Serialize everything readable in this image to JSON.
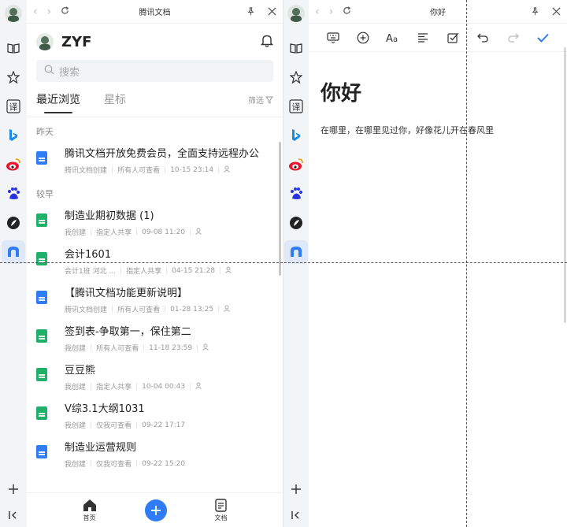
{
  "left_window": {
    "title": "腾讯文档",
    "user_name": "ZYF",
    "search_placeholder": "搜索",
    "tabs": [
      {
        "label": "最近浏览",
        "active": true
      },
      {
        "label": "星标",
        "active": false
      }
    ],
    "filter_label": "筛选",
    "groups": [
      {
        "label": "昨天",
        "items": [
          {
            "type": "doc",
            "title": "腾讯文档开放免费会员，全面支持远程办公",
            "meta": [
              "腾讯文档创建",
              "所有人可查看",
              "10-15 23:14"
            ],
            "collab_icon": true
          }
        ]
      },
      {
        "label": "较早",
        "items": [
          {
            "type": "sheet",
            "title": "制造业期初数据 (1)",
            "meta": [
              "我创建",
              "指定人共享",
              "09-08 11:20"
            ],
            "collab_icon": true
          },
          {
            "type": "sheet",
            "title": "会计1601",
            "meta": [
              "会计1班 河北 ...",
              "指定人共享",
              "04-15 21:28"
            ],
            "collab_icon": true
          },
          {
            "type": "doc",
            "title": "【腾讯文档功能更新说明】",
            "meta": [
              "腾讯文档创建",
              "所有人可查看",
              "01-28 13:25"
            ],
            "collab_icon": true
          },
          {
            "type": "sheet",
            "title": "签到表-争取第一，保住第二",
            "meta": [
              "我创建",
              "所有人可查看",
              "11-18 23:59"
            ],
            "collab_icon": true
          },
          {
            "type": "sheet",
            "title": "豆豆熊",
            "meta": [
              "我创建",
              "指定人共享",
              "10-04 00:43"
            ],
            "collab_icon": true
          },
          {
            "type": "sheet",
            "title": "V综3.1大纲1031",
            "meta": [
              "我创建",
              "仅我可查看",
              "09-22 17:17"
            ],
            "collab_icon": false
          },
          {
            "type": "doc",
            "title": "制造业运营规则",
            "meta": [
              "我创建",
              "仅我可查看",
              "09-22 15:20"
            ],
            "collab_icon": false
          }
        ]
      }
    ],
    "bottom_nav": {
      "home": "首页",
      "docs": "文档"
    }
  },
  "right_window": {
    "title": "你好",
    "doc_heading": "你好",
    "doc_body": "在哪里，在哪里见过你，好像花儿开在春风里"
  },
  "colors": {
    "accent": "#2f7cf6",
    "sheet_green": "#1fb16a",
    "sidebar_bg": "#f3f4f6"
  }
}
